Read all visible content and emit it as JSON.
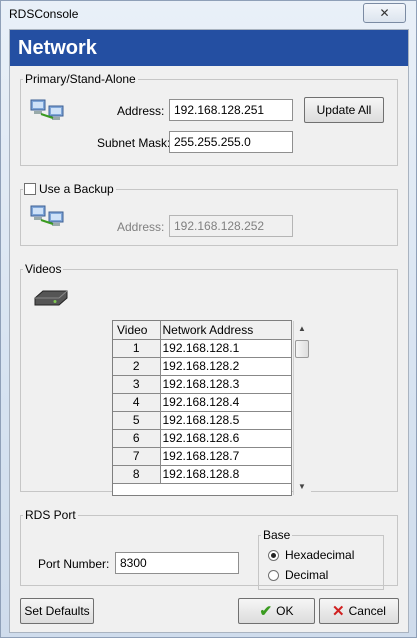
{
  "window": {
    "title": "RDSConsole",
    "close_glyph": "✕"
  },
  "header": {
    "title": "Network"
  },
  "primary": {
    "legend": "Primary/Stand-Alone",
    "address_label": "Address:",
    "address_value": "192.168.128.251",
    "subnet_label": "Subnet Mask:",
    "subnet_value": "255.255.255.0",
    "update_button": "Update All"
  },
  "backup": {
    "checkbox_label": "Use a Backup",
    "checked": false,
    "address_label": "Address:",
    "address_value": "192.168.128.252"
  },
  "videos": {
    "legend": "Videos",
    "columns": [
      "Video",
      "Network Address"
    ],
    "rows": [
      [
        "1",
        "192.168.128.1"
      ],
      [
        "2",
        "192.168.128.2"
      ],
      [
        "3",
        "192.168.128.3"
      ],
      [
        "4",
        "192.168.128.4"
      ],
      [
        "5",
        "192.168.128.5"
      ],
      [
        "6",
        "192.168.128.6"
      ],
      [
        "7",
        "192.168.128.7"
      ],
      [
        "8",
        "192.168.128.8"
      ]
    ]
  },
  "rds_port": {
    "legend": "RDS Port",
    "port_label": "Port Number:",
    "port_value": "8300",
    "base_legend": "Base",
    "base_options": [
      "Hexadecimal",
      "Decimal"
    ],
    "selected_base": "Hexadecimal"
  },
  "footer": {
    "set_defaults": "Set Defaults",
    "ok": "OK",
    "cancel": "Cancel"
  },
  "colors": {
    "header_bg": "#244fa2",
    "ok_check": "#3a9b20",
    "cancel_x": "#d02020"
  }
}
